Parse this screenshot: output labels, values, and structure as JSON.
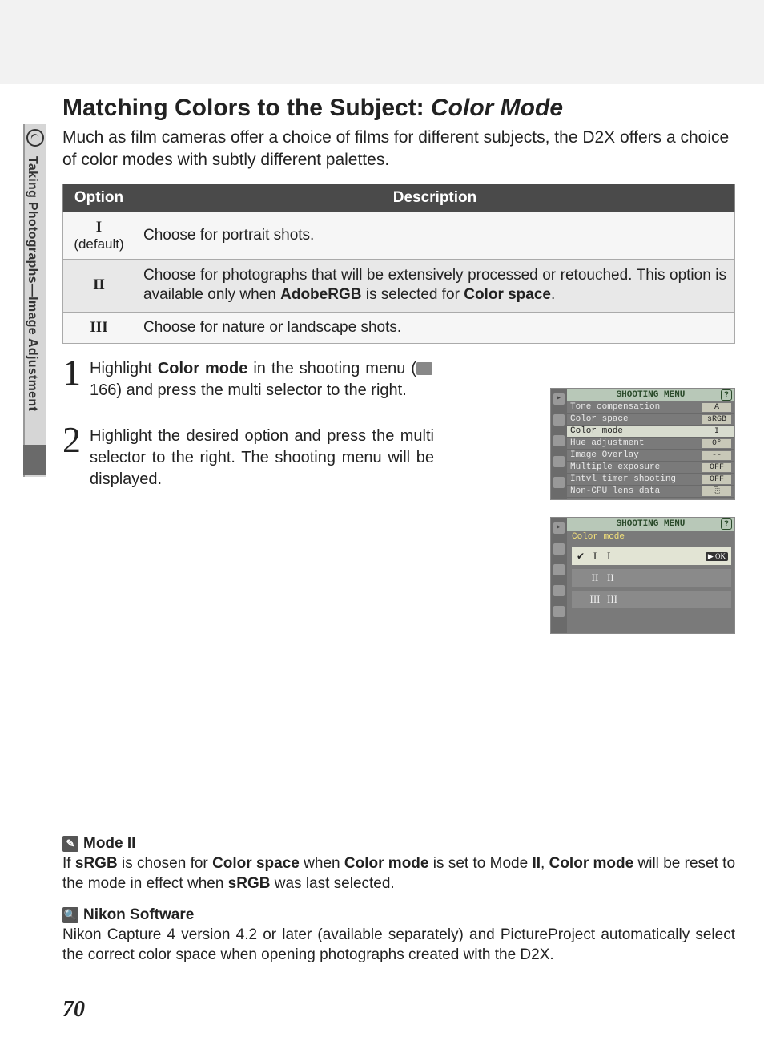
{
  "side_tab": {
    "label": "Taking Photographs—Image Adjustment"
  },
  "heading": {
    "prefix": "Matching Colors to the Subject: ",
    "italic": "Color Mode"
  },
  "intro": "Much as film cameras offer a choice of films for different subjects, the D2X offers a choice of color modes with subtly different palettes.",
  "table": {
    "head_option": "Option",
    "head_desc": "Description",
    "rows": [
      {
        "opt_main": "I",
        "opt_sub": "(default)",
        "desc": "Choose for portrait shots."
      },
      {
        "opt_main": "II",
        "opt_sub": "",
        "desc_parts": {
          "p1": "Choose for photographs that will be extensively processed or retouched. This option is available only when ",
          "b1": "AdobeRGB",
          "p2": " is selected for ",
          "b2": "Color space",
          "p3": "."
        }
      },
      {
        "opt_main": "III",
        "opt_sub": "",
        "desc": "Choose for nature or landscape shots."
      }
    ]
  },
  "steps": {
    "s1": {
      "num": "1",
      "p1": "Highlight ",
      "b1": "Color mode",
      "p2": " in the shooting menu (",
      "ref_icon": "cross-reference-icon",
      "ref": " 166) and press the multi selector to the right."
    },
    "s2": {
      "num": "2",
      "text": "Highlight the desired option and press the multi selector to the right.  The shooting menu will be displayed."
    }
  },
  "lcd1": {
    "title": "SHOOTING MENU",
    "help": "?",
    "rows": [
      {
        "label": "Tone compensation",
        "val": "A"
      },
      {
        "label": "Color space",
        "val": "sRGB"
      },
      {
        "label": "Color mode",
        "val": "I",
        "sel": true
      },
      {
        "label": "Hue adjustment",
        "val": "0°"
      },
      {
        "label": "Image Overlay",
        "val": "--"
      },
      {
        "label": "Multiple exposure",
        "val": "OFF"
      },
      {
        "label": "Intvl timer shooting",
        "val": "OFF"
      },
      {
        "label": "Non-CPU lens data",
        "val": "⎘"
      }
    ]
  },
  "lcd2": {
    "title": "SHOOTING MENU",
    "help": "?",
    "subtitle": "Color mode",
    "ok": "▶ OK",
    "options": [
      {
        "glyph": "I",
        "label": "I",
        "checked": true,
        "sel": true
      },
      {
        "glyph": "II",
        "label": "II"
      },
      {
        "glyph": "III",
        "label": "III"
      }
    ]
  },
  "notes": {
    "n1": {
      "badge": "✎",
      "title": "Mode II",
      "p1": "If ",
      "b1": "sRGB",
      "p2": " is chosen for ",
      "b2": "Color space",
      "p3": " when ",
      "b3": "Color mode",
      "p4": " is set to Mode ",
      "b4": "II",
      "p5": ", ",
      "b5": "Color mode",
      "p6": " will be reset to the mode in effect when ",
      "b6": "sRGB",
      "p7": " was last selected."
    },
    "n2": {
      "badge": "🔍",
      "title": "Nikon Software",
      "body": "Nikon Capture 4 version 4.2 or later (available separately) and PictureProject automatically select the correct color space when opening photographs created with the D2X."
    }
  },
  "page_number": "70"
}
